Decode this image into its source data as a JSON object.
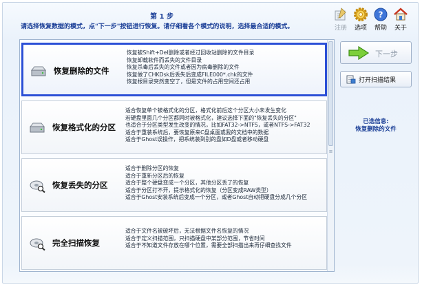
{
  "header": {
    "step_title": "第 1 步",
    "step_description": "请选择恢复数据的模式，点\"下一步\"按钮进行恢复。请仔细看各个模式的说明，选择最合适的模式。"
  },
  "toolbar": {
    "items": [
      {
        "label": "注册",
        "icon": "register-icon",
        "enabled": false
      },
      {
        "label": "选项",
        "icon": "gear-icon",
        "enabled": true
      },
      {
        "label": "帮助",
        "icon": "help-icon",
        "enabled": true
      },
      {
        "label": "关于",
        "icon": "home-icon",
        "enabled": true
      }
    ]
  },
  "modes": [
    {
      "title": "恢复删除的文件",
      "selected": true,
      "icon": "drive-icon",
      "lines": [
        "恢复被Shift+Del删除或者经过回收站删除的文件目录",
        "恢复卸载软件而丢失的文件目录",
        "恢复杀毒后丢失的文件或者因为病毒删除的文件",
        "恢复做了CHKDsk后丢失后变成FILE000*.chk的文件",
        "恢复根目录突然变空了，但是文件的占用空间还占用"
      ]
    },
    {
      "title": "恢复格式化的分区",
      "selected": false,
      "icon": "drive-icon",
      "lines": [
        "适合恢复单个被格式化的分区，格式化前后这个分区大小未发生变化",
        "若硬盘里面几个分区都同时被格式化，建议选择下面的\"恢复丢失的分区\"",
        "也适合于分区类型发生改变的情况，比如FAT32->NTFS，或者NTFS->FAT32",
        "适合于重装系统后，要恢复原来C盘桌面或我的文档中的数据",
        "适合于Ghost误操作，把系统装到别的盘如D盘或者移动硬盘"
      ]
    },
    {
      "title": "恢复丢失的分区",
      "selected": false,
      "icon": "drive-search-icon",
      "lines": [
        "适合于删除分区的恢复",
        "适合于重新分区后的恢复",
        "适合于整个硬盘变成一个分区，其他分区丢了的恢复",
        "适合于分区打不开，提示格式化的恢复（分区变成RAW类型）",
        "适合于Ghost安装系统后变成一个分区，或者Ghost自动把硬盘分成几个分区"
      ]
    },
    {
      "title": "完全扫描恢复",
      "selected": false,
      "icon": "drive-search-icon",
      "lines": [
        "适合于文件名被破坏后，无法根据文件名恢复的情况",
        "适合于定义扫描范围，只扫描硬盘中某部分范围，节省时间",
        "适合于不知道文件存放在哪个位置，需要全部扫描出来再仔细查找文件"
      ]
    }
  ],
  "side": {
    "next_label": "下一步",
    "open_label": "打开扫描结果",
    "selected_caption": "已选信息:",
    "selected_value": "恢复删除的文件"
  }
}
